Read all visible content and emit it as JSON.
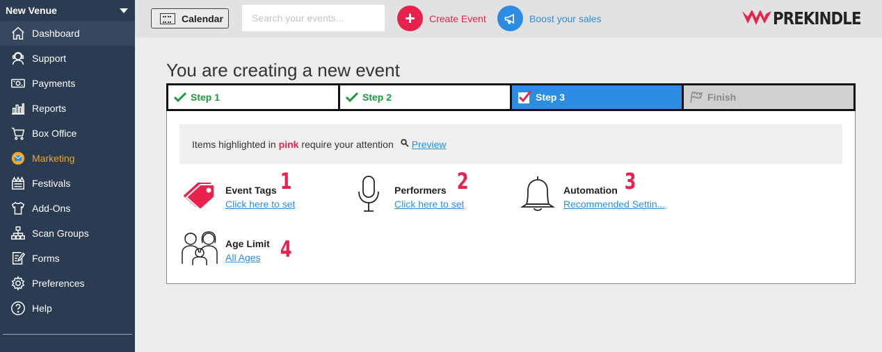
{
  "sidebar": {
    "venue": "New Venue",
    "items": [
      {
        "label": "Dashboard",
        "icon": "home-icon"
      },
      {
        "label": "Support",
        "icon": "support-icon"
      },
      {
        "label": "Payments",
        "icon": "payments-icon"
      },
      {
        "label": "Reports",
        "icon": "reports-icon"
      },
      {
        "label": "Box Office",
        "icon": "cart-icon"
      },
      {
        "label": "Marketing",
        "icon": "marketing-icon"
      },
      {
        "label": "Festivals",
        "icon": "festivals-icon"
      },
      {
        "label": "Add-Ons",
        "icon": "shirt-icon"
      },
      {
        "label": "Scan Groups",
        "icon": "scan-groups-icon"
      },
      {
        "label": "Forms",
        "icon": "forms-icon"
      },
      {
        "label": "Preferences",
        "icon": "gear-icon"
      },
      {
        "label": "Help",
        "icon": "help-icon"
      }
    ]
  },
  "topbar": {
    "calendar_label": "Calendar",
    "search_placeholder": "Search your events...",
    "create_label": "Create Event",
    "boost_label": "Boost your sales",
    "logo_text": "PREKINDLE"
  },
  "main": {
    "title": "You are creating a new event",
    "steps": [
      {
        "label": "Step 1",
        "state": "done"
      },
      {
        "label": "Step 2",
        "state": "done"
      },
      {
        "label": "Step 3",
        "state": "current"
      },
      {
        "label": "Finish",
        "state": "pending"
      }
    ],
    "notice": {
      "before": "Items highlighted in",
      "pink": "pink",
      "after": "require your attention",
      "preview": "Preview"
    },
    "items": [
      {
        "label": "Event Tags",
        "link": "Click here to set",
        "number": "1"
      },
      {
        "label": "Performers",
        "link": "Click here to set",
        "number": "2"
      },
      {
        "label": "Automation",
        "link": "Recommended Settin...",
        "number": "3"
      },
      {
        "label": "Age Limit",
        "link": "All Ages",
        "number": "4"
      }
    ]
  },
  "colors": {
    "sidebar_bg": "#2a3b52",
    "accent_pink": "#e8224d",
    "accent_blue": "#2a8ce3",
    "success_green": "#1a9a3a",
    "marketing_orange": "#f5a623"
  }
}
